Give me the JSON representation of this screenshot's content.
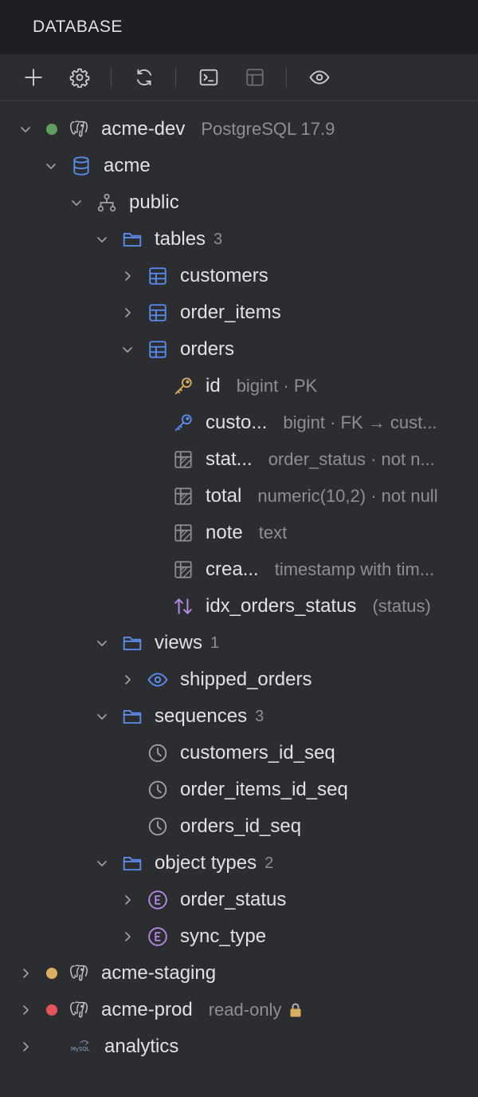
{
  "panel": {
    "title": "DATABASE"
  },
  "colors": {
    "connected": "#5fa05f",
    "staging": "#d9b061",
    "prod": "#e5545b",
    "accent": "#5b8def",
    "enum": "#b78ae6"
  },
  "tree": {
    "dev": {
      "name": "acme-dev",
      "version": "PostgreSQL 17.9"
    },
    "db": {
      "name": "acme"
    },
    "schema": {
      "name": "public"
    },
    "tables": {
      "label": "tables",
      "count": "3",
      "items": [
        {
          "name": "customers"
        },
        {
          "name": "order_items"
        },
        {
          "name": "orders"
        }
      ],
      "columns": [
        {
          "name": "id",
          "meta": "bigint · PK"
        },
        {
          "name": "custo...",
          "meta": "bigint · FK → cust..."
        },
        {
          "name": "stat...",
          "meta": "order_status · not n..."
        },
        {
          "name": "total",
          "meta": "numeric(10,2) · not null"
        },
        {
          "name": "note",
          "meta": "text"
        },
        {
          "name": "crea...",
          "meta": "timestamp with tim..."
        }
      ],
      "index": {
        "name": "idx_orders_status",
        "meta": "(status)"
      }
    },
    "views": {
      "label": "views",
      "count": "1",
      "items": [
        {
          "name": "shipped_orders"
        }
      ]
    },
    "sequences": {
      "label": "sequences",
      "count": "3",
      "items": [
        {
          "name": "customers_id_seq"
        },
        {
          "name": "order_items_id_seq"
        },
        {
          "name": "orders_id_seq"
        }
      ]
    },
    "types": {
      "label": "object types",
      "count": "2",
      "items": [
        {
          "name": "order_status"
        },
        {
          "name": "sync_type"
        }
      ]
    },
    "staging": {
      "name": "acme-staging"
    },
    "prod": {
      "name": "acme-prod",
      "meta": "read-only"
    },
    "analytics": {
      "name": "analytics",
      "logo": "MySQL"
    }
  }
}
